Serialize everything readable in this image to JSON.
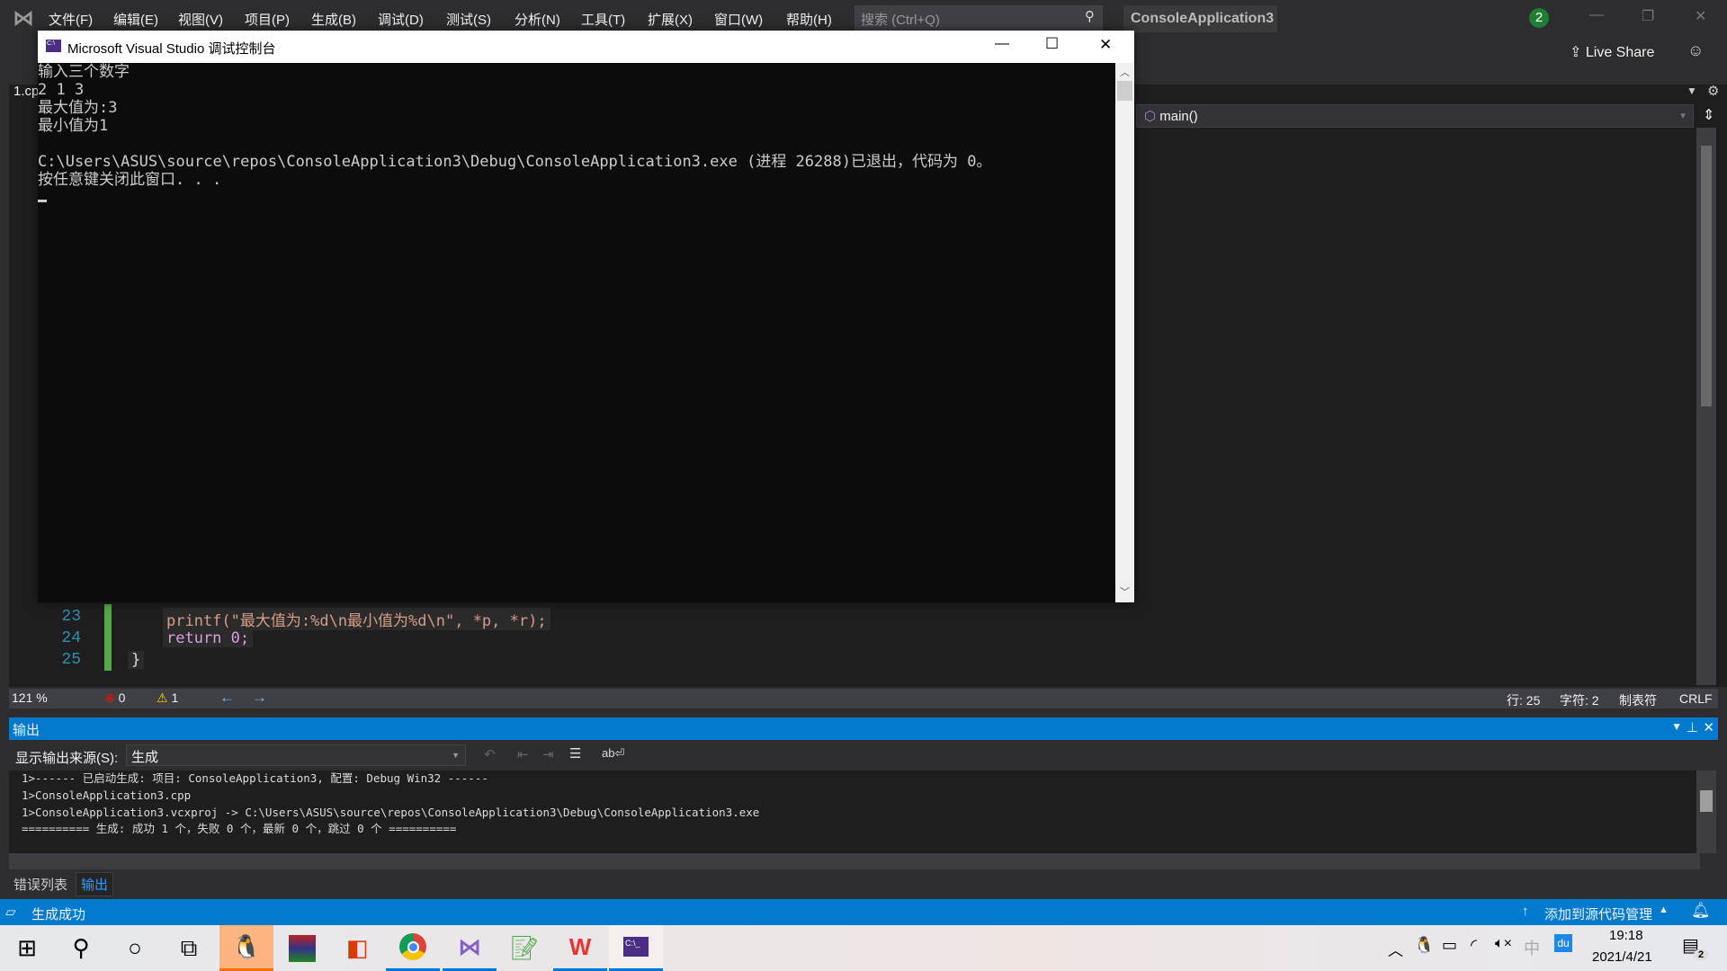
{
  "menubar": {
    "items": [
      "文件(F)",
      "编辑(E)",
      "视图(V)",
      "项目(P)",
      "生成(B)",
      "调试(D)",
      "测试(S)",
      "分析(N)",
      "工具(T)",
      "扩展(X)",
      "窗口(W)",
      "帮助(H)"
    ],
    "search_placeholder": "搜索 (Ctrl+Q)",
    "project_name": "ConsoleApplication3",
    "notification_count": "2",
    "live_share": "Live Share"
  },
  "editor": {
    "file_tab": "1.cp",
    "nav_member": "main()",
    "lines": [
      {
        "num": "23",
        "code": "printf(\"最大值为:%d\\n最小值为%d\\n\", *p, *r);"
      },
      {
        "num": "24",
        "code": "return 0;"
      },
      {
        "num": "25",
        "code": "}"
      }
    ],
    "status": {
      "zoom": "121 %",
      "errors": "0",
      "warnings": "1",
      "line": "行: 25",
      "char": "字符: 2",
      "indent": "制表符",
      "eol": "CRLF"
    }
  },
  "console": {
    "title": "Microsoft Visual Studio 调试控制台",
    "lines": [
      "输入三个数字",
      "2 1 3",
      "最大值为:3",
      "最小值为1",
      "",
      "C:\\Users\\ASUS\\source\\repos\\ConsoleApplication3\\Debug\\ConsoleApplication3.exe (进程 26288)已退出，代码为 0。",
      "按任意键关闭此窗口. . ."
    ]
  },
  "output": {
    "title": "输出",
    "source_label": "显示输出来源(S):",
    "source_value": "生成",
    "lines": [
      "1>------ 已启动生成: 项目: ConsoleApplication3, 配置: Debug Win32 ------",
      "1>ConsoleApplication3.cpp",
      "1>ConsoleApplication3.vcxproj -> C:\\Users\\ASUS\\source\\repos\\ConsoleApplication3\\Debug\\ConsoleApplication3.exe",
      "========== 生成: 成功 1 个，失败 0 个，最新 0 个，跳过 0 个 =========="
    ]
  },
  "bottom_tabs": [
    "错误列表",
    "输出"
  ],
  "statusbar": {
    "message": "生成成功",
    "source_control": "添加到源代码管理"
  },
  "taskbar": {
    "time": "19:18",
    "date": "2021/4/21",
    "notifications": "2",
    "ime": "中",
    "apps": [
      "qq",
      "winrar",
      "office",
      "chrome",
      "visual-studio",
      "notepad-plus-plus",
      "wps",
      "console"
    ]
  },
  "colors": {
    "accent": "#007acc",
    "editor_bg": "#1e1e1e",
    "console_bg": "#0c0c0c"
  }
}
